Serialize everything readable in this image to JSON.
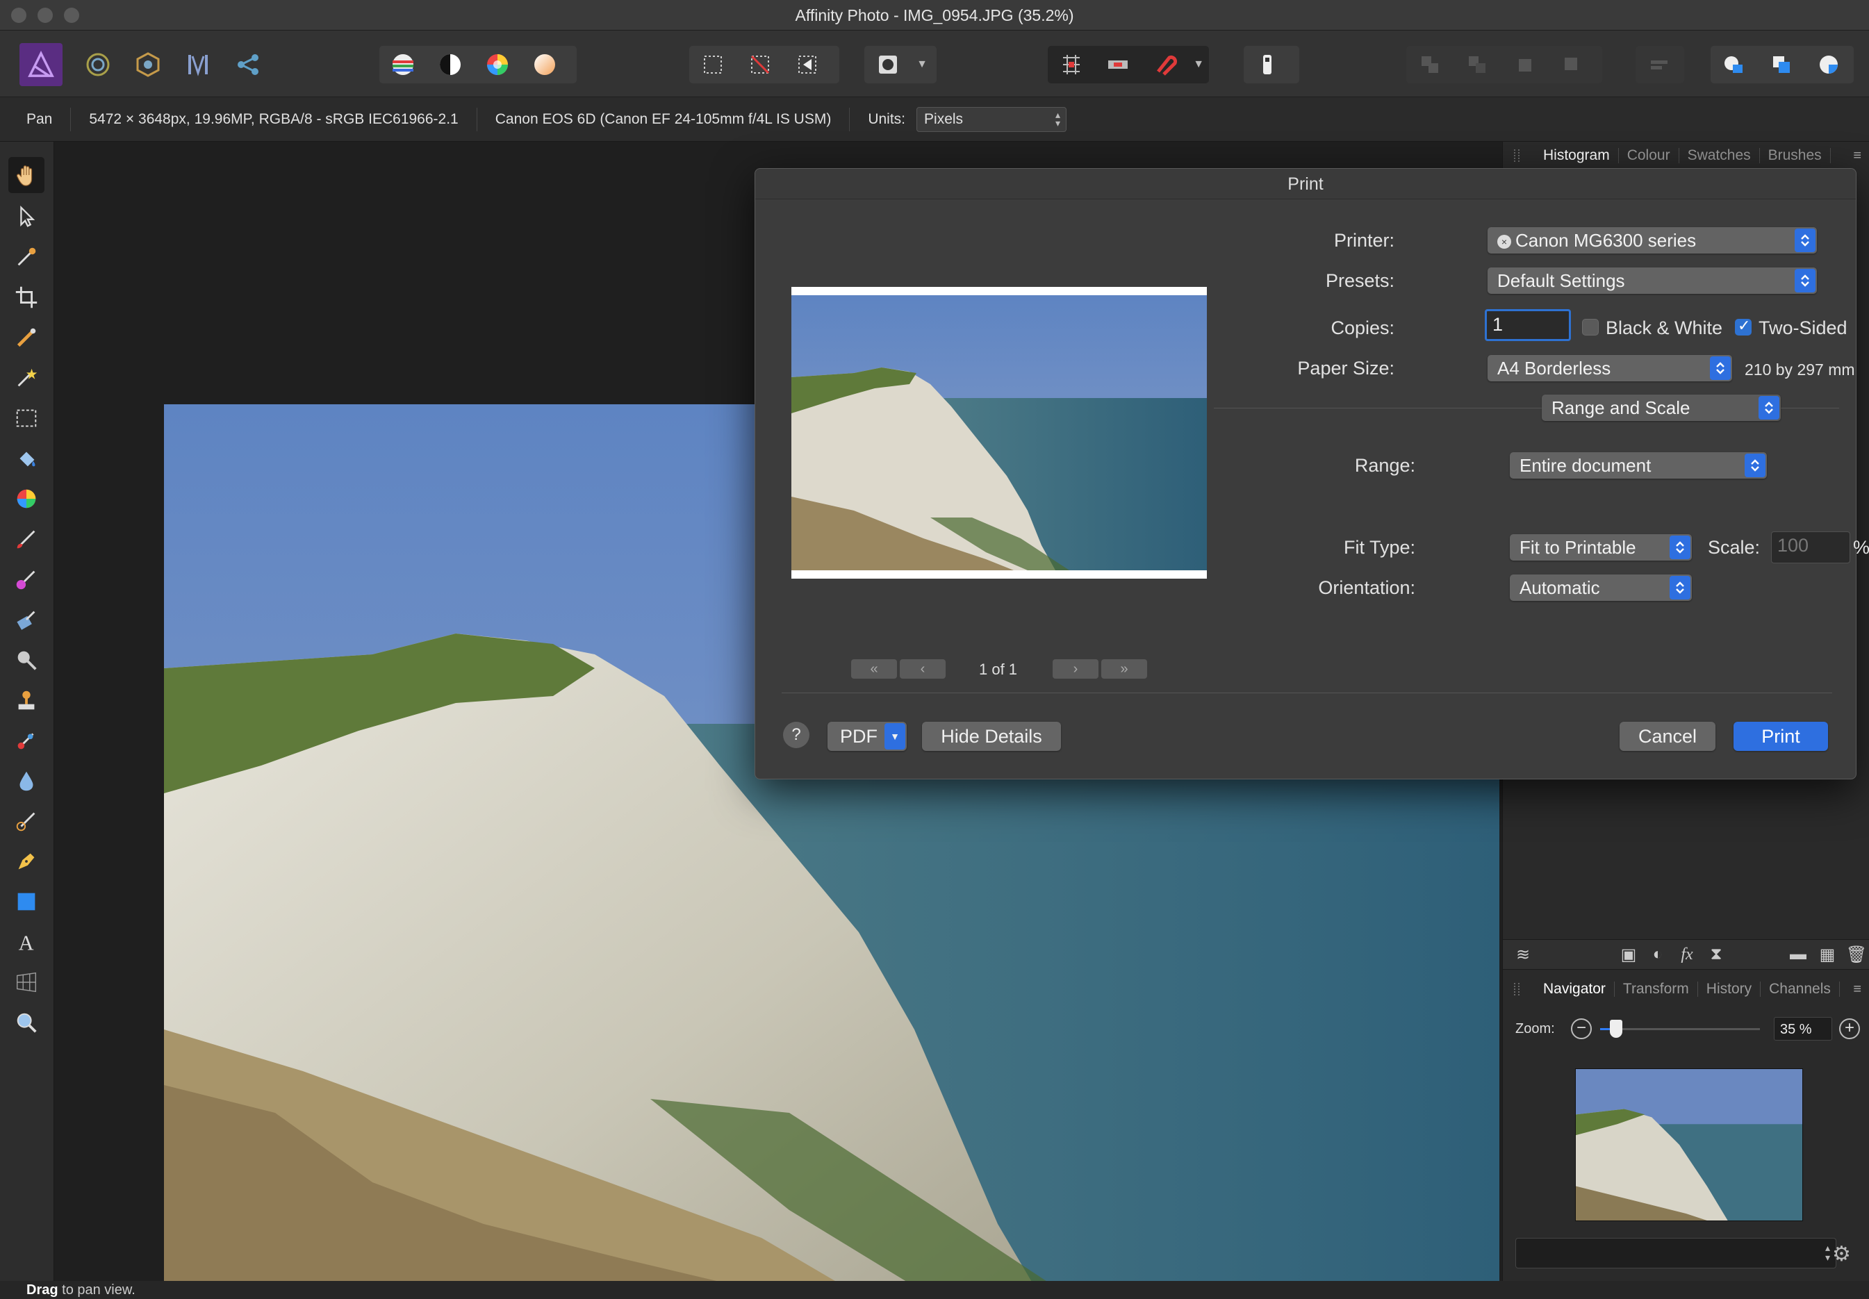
{
  "window": {
    "title": "Affinity Photo - IMG_0954.JPG (35.2%)"
  },
  "context_bar": {
    "tool": "Pan",
    "doc_info": "5472 × 3648px, 19.96MP, RGBA/8 - sRGB IEC61966-2.1",
    "camera": "Canon EOS 6D (Canon EF 24-105mm f/4L IS USM)",
    "units_label": "Units:",
    "units_value": "Pixels"
  },
  "toolbar_icons": [
    "photo-persona-icon",
    "liquify-persona-icon",
    "develop-persona-icon",
    "tone-mapping-persona-icon",
    "export-persona-icon",
    "levels-icon",
    "contrast-icon",
    "color-wheel-icon",
    "white-balance-icon",
    "marquee-icon",
    "deselect-icon",
    "invert-selection-icon",
    "quick-mask-icon",
    "snapping-icon",
    "assistant-icon"
  ],
  "panels": {
    "top_tabs": [
      "Histogram",
      "Colour",
      "Swatches",
      "Brushes"
    ],
    "bottom_tabs": [
      "Navigator",
      "Transform",
      "History",
      "Channels"
    ],
    "zoom_label": "Zoom:",
    "zoom_value": "35 %",
    "zoom_fraction": 0.1
  },
  "status": {
    "bold": "Drag",
    "rest": " to pan view."
  },
  "print_dialog": {
    "title": "Print",
    "printer_label": "Printer:",
    "printer_value": "Canon MG6300 series",
    "presets_label": "Presets:",
    "presets_value": "Default Settings",
    "copies_label": "Copies:",
    "copies_value": "1",
    "bw_label": "Black & White",
    "two_sided_label": "Two-Sided",
    "paper_label": "Paper Size:",
    "paper_value": "A4 Borderless",
    "paper_dims": "210 by 297 mm",
    "section_value": "Range and Scale",
    "range_label": "Range:",
    "range_value": "Entire document",
    "fit_label": "Fit Type:",
    "fit_value": "Fit to Printable",
    "scale_label": "Scale:",
    "scale_value": "100",
    "scale_unit": "%",
    "orient_label": "Orientation:",
    "orient_value": "Automatic",
    "page_indicator": "1 of 1",
    "help_label": "?",
    "pdf_label": "PDF",
    "hide_details_label": "Hide Details",
    "cancel_label": "Cancel",
    "print_label": "Print"
  }
}
